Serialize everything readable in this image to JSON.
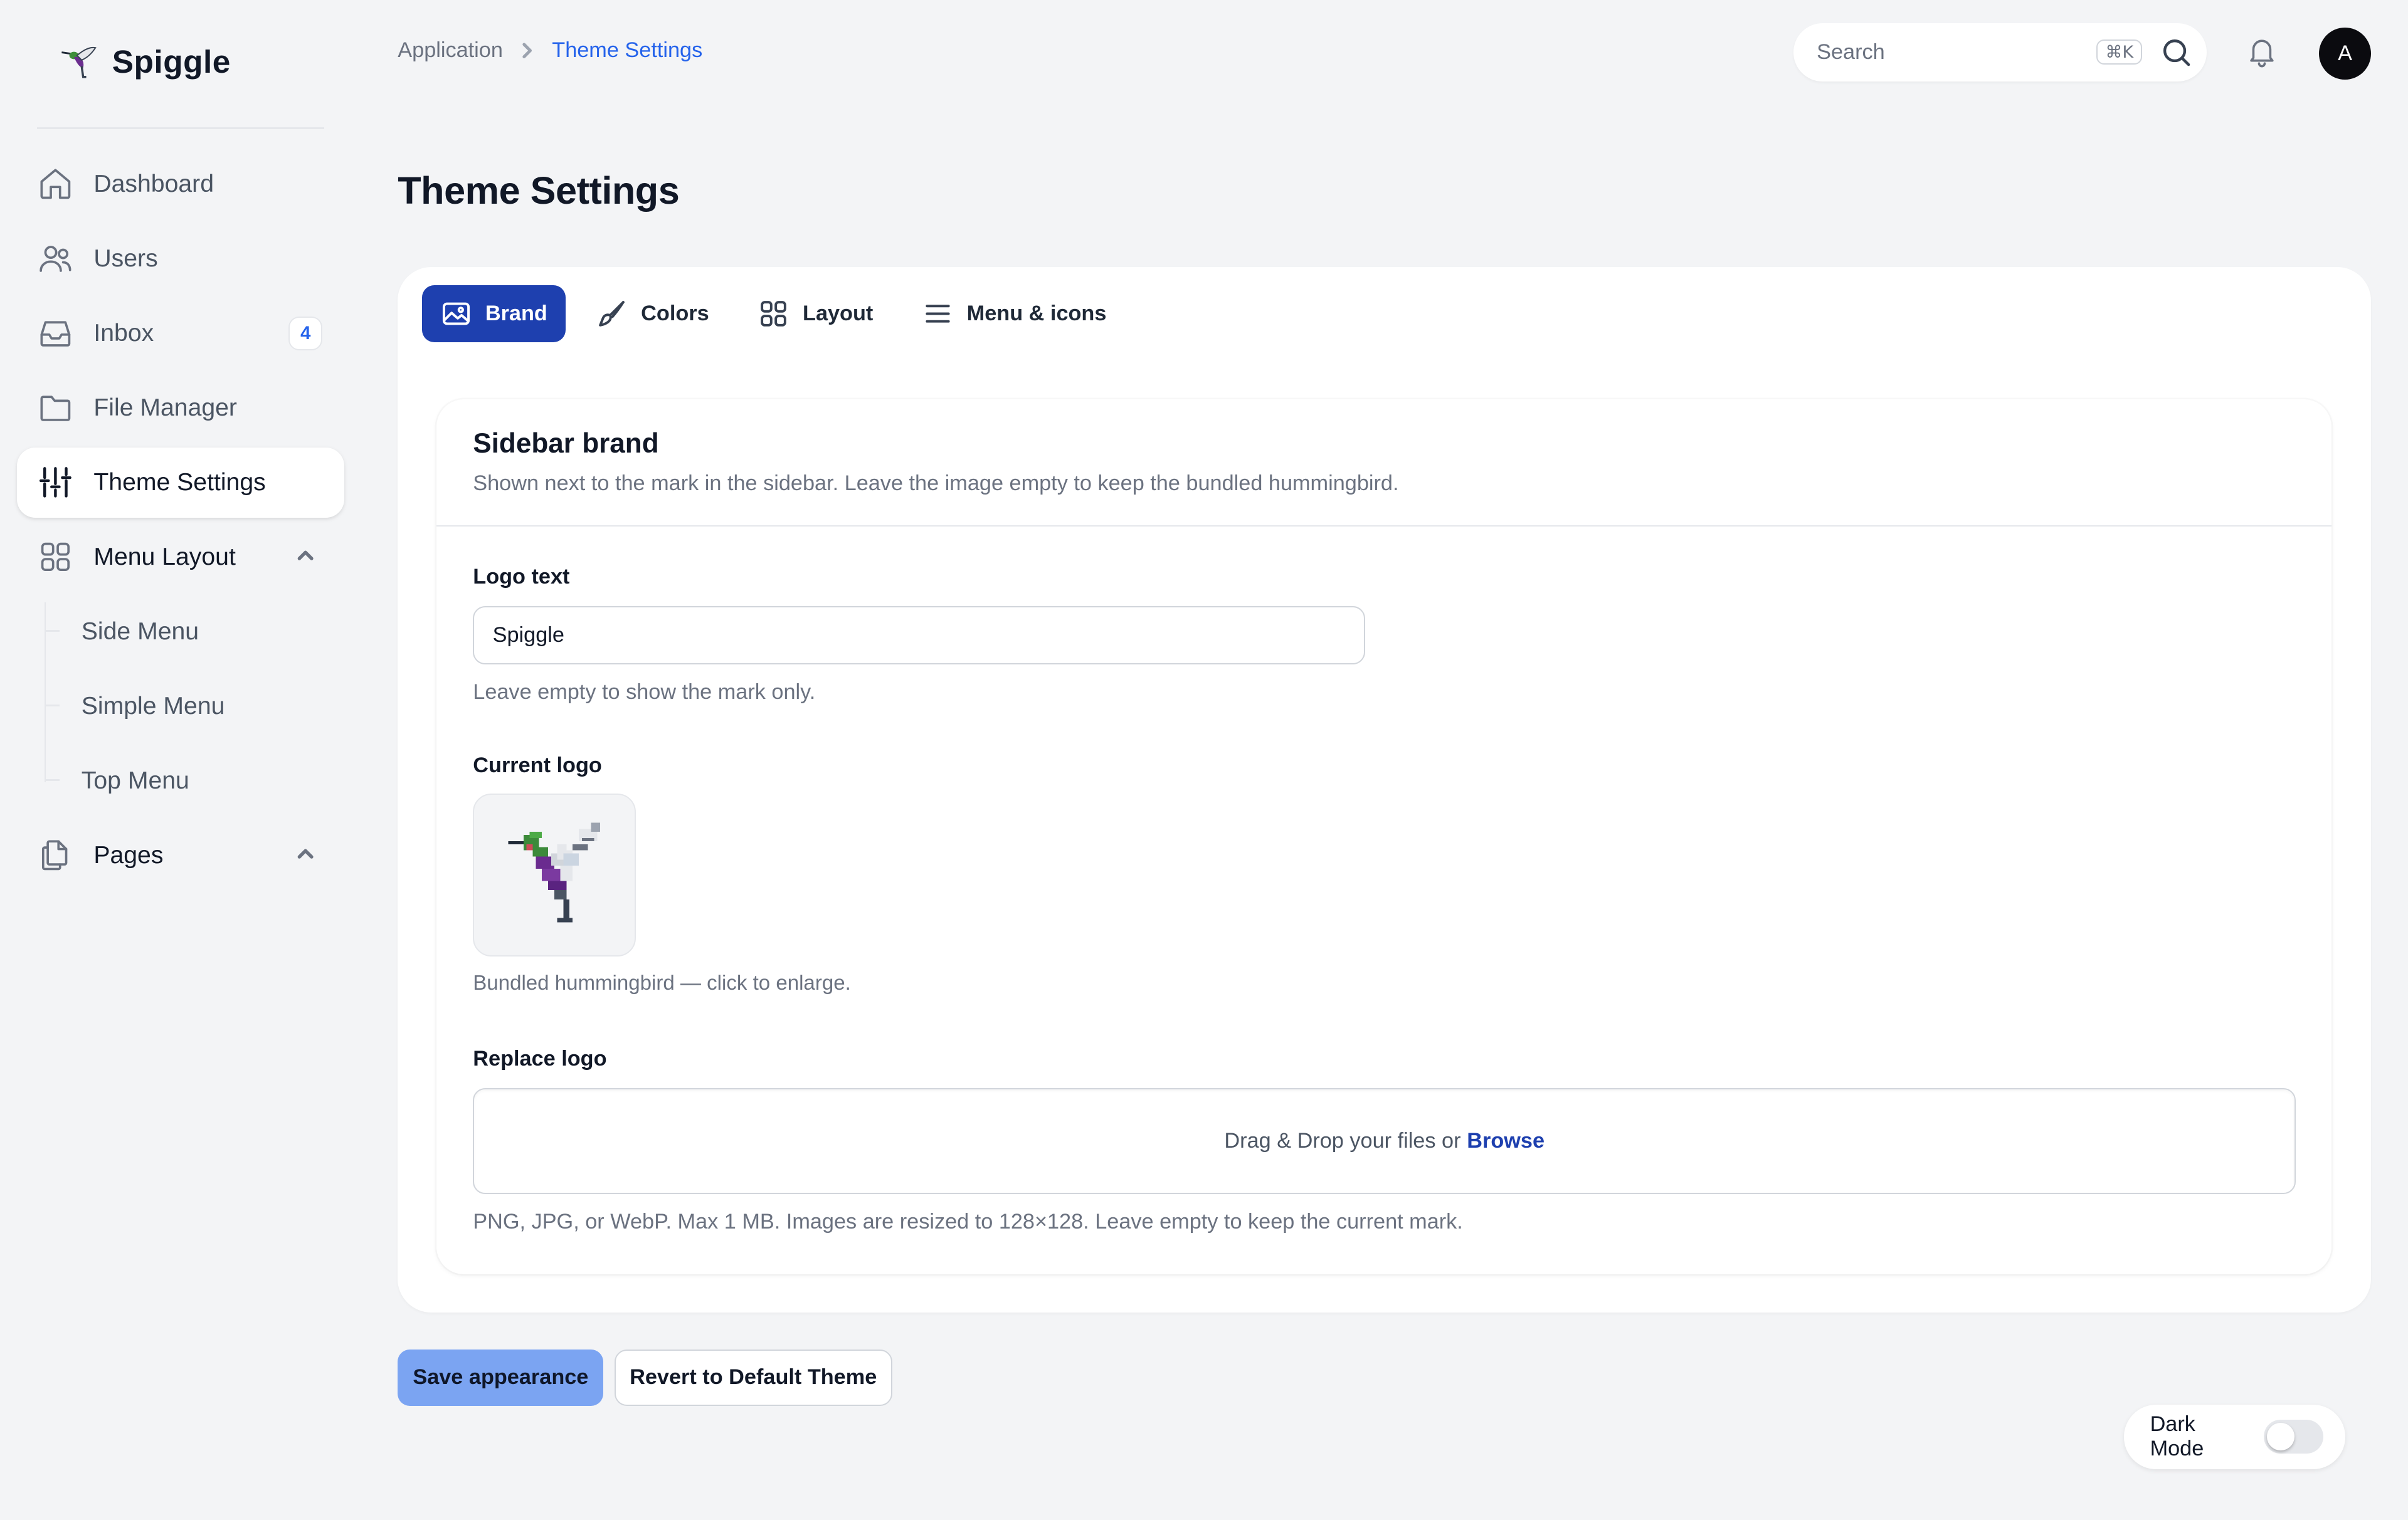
{
  "app": {
    "name": "Spiggle",
    "logo_icon": "hummingbird-icon"
  },
  "sidebar": {
    "items": [
      {
        "label": "Dashboard",
        "icon": "home-icon"
      },
      {
        "label": "Users",
        "icon": "users-icon"
      },
      {
        "label": "Inbox",
        "icon": "inbox-icon",
        "badge": "4"
      },
      {
        "label": "File Manager",
        "icon": "folder-icon"
      },
      {
        "label": "Theme Settings",
        "icon": "sliders-icon",
        "active": true
      },
      {
        "label": "Menu Layout",
        "icon": "grid-icon",
        "expanded": true
      },
      {
        "label": "Pages",
        "icon": "pages-icon",
        "expanded": true
      }
    ],
    "menu_layout_children": [
      "Side Menu",
      "Simple Menu",
      "Top Menu"
    ]
  },
  "breadcrumb": {
    "parent": "Application",
    "current": "Theme Settings"
  },
  "search": {
    "placeholder": "Search",
    "shortcut": "⌘K"
  },
  "user": {
    "avatar_initial": "A"
  },
  "page": {
    "title": "Theme Settings"
  },
  "tabs": [
    {
      "label": "Brand",
      "icon": "image-icon",
      "active": true
    },
    {
      "label": "Colors",
      "icon": "brush-icon"
    },
    {
      "label": "Layout",
      "icon": "layout-grid-icon"
    },
    {
      "label": "Menu & icons",
      "icon": "menu-lines-icon"
    }
  ],
  "brand_section": {
    "title": "Sidebar brand",
    "description": "Shown next to the mark in the sidebar. Leave the image empty to keep the bundled hummingbird.",
    "logo_text_label": "Logo text",
    "logo_text_value": "Spiggle",
    "logo_text_help": "Leave empty to show the mark only.",
    "current_logo_label": "Current logo",
    "current_logo_help": "Bundled hummingbird — click to enlarge.",
    "replace_logo_label": "Replace logo",
    "dropzone_text": "Drag & Drop your files or",
    "dropzone_link": "Browse",
    "replace_logo_help": "PNG, JPG, or WebP. Max 1 MB. Images are resized to 128×128. Leave empty to keep the current mark."
  },
  "actions": {
    "save": "Save appearance",
    "revert": "Revert to Default Theme"
  },
  "dark_mode": {
    "label": "Dark Mode",
    "enabled": false
  },
  "colors": {
    "accent": "#1e40af",
    "link": "#2563eb",
    "save_button": "#7ba4f2",
    "background": "#f3f4f6"
  }
}
